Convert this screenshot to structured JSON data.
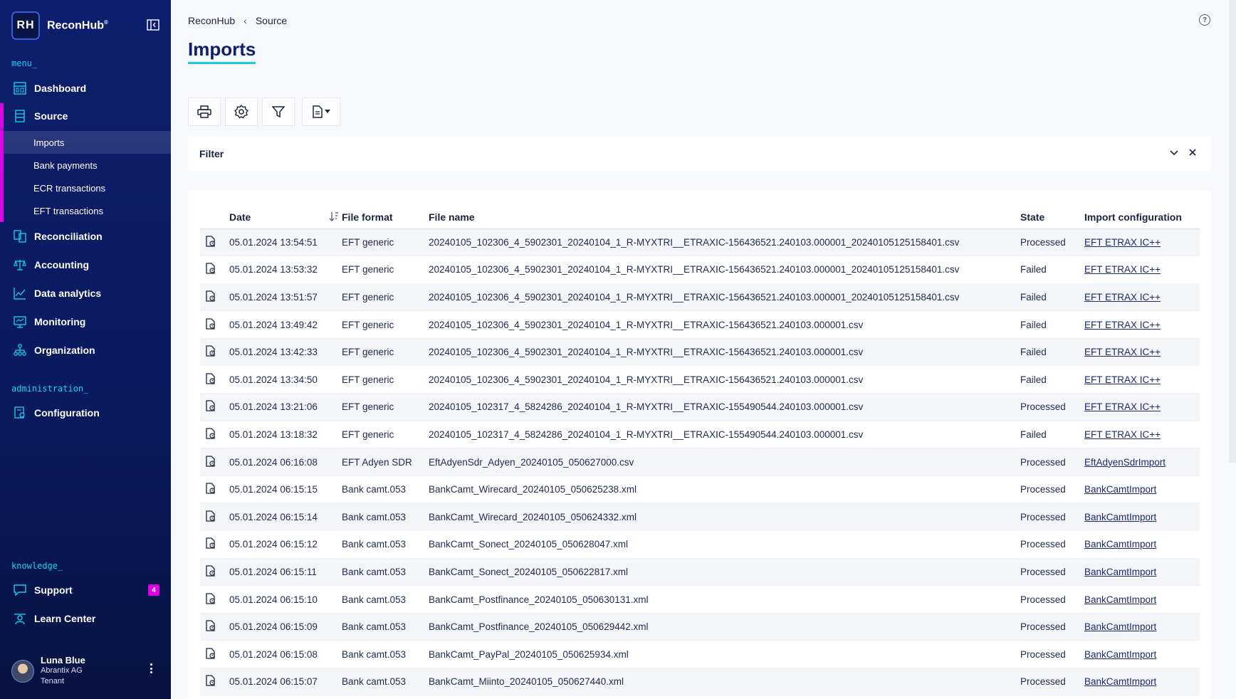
{
  "app": {
    "name": "ReconHub",
    "logo_initials": "RH",
    "logo_mark": "®"
  },
  "sidebar": {
    "menu_label": "menu_",
    "admin_label": "administration_",
    "knowledge_label": "knowledge_",
    "items": [
      {
        "label": "Dashboard",
        "icon": "dashboard-icon"
      },
      {
        "label": "Source",
        "icon": "source-icon"
      },
      {
        "label": "Reconciliation",
        "icon": "reconciliation-icon"
      },
      {
        "label": "Accounting",
        "icon": "scales-icon"
      },
      {
        "label": "Data analytics",
        "icon": "chart-line-icon"
      },
      {
        "label": "Monitoring",
        "icon": "monitoring-icon"
      },
      {
        "label": "Organization",
        "icon": "org-tree-icon"
      }
    ],
    "source_sub": [
      {
        "label": "Imports"
      },
      {
        "label": "Bank payments"
      },
      {
        "label": "ECR transactions"
      },
      {
        "label": "EFT transactions"
      }
    ],
    "admin_items": [
      {
        "label": "Configuration",
        "icon": "config-icon"
      }
    ],
    "knowledge_items": [
      {
        "label": "Support",
        "icon": "chat-icon",
        "badge": "4"
      },
      {
        "label": "Learn Center",
        "icon": "learn-icon"
      }
    ],
    "user": {
      "name": "Luna Blue",
      "company": "Abrantix AG",
      "role": "Tenant"
    }
  },
  "breadcrumb": {
    "root": "ReconHub",
    "current": "Source"
  },
  "page": {
    "title": "Imports"
  },
  "filter": {
    "label": "Filter"
  },
  "colors": {
    "accent": "#18c9e9",
    "highlight": "#e000e6",
    "sidebar": "#0d1e6e"
  },
  "table": {
    "headers": {
      "date": "Date",
      "format": "File format",
      "name": "File name",
      "state": "State",
      "config": "Import configuration"
    },
    "rows": [
      {
        "date": "05.01.2024 13:54:51",
        "format": "EFT generic",
        "name": "20240105_102306_4_5902301_20240104_1_R-MYXTRI__ETRAXIC-156436521.240103.000001_20240105125158401.csv",
        "state": "Processed",
        "config": "EFT ETRAX IC++"
      },
      {
        "date": "05.01.2024 13:53:32",
        "format": "EFT generic",
        "name": "20240105_102306_4_5902301_20240104_1_R-MYXTRI__ETRAXIC-156436521.240103.000001_20240105125158401.csv",
        "state": "Failed",
        "config": "EFT ETRAX IC++"
      },
      {
        "date": "05.01.2024 13:51:57",
        "format": "EFT generic",
        "name": "20240105_102306_4_5902301_20240104_1_R-MYXTRI__ETRAXIC-156436521.240103.000001_20240105125158401.csv",
        "state": "Failed",
        "config": "EFT ETRAX IC++"
      },
      {
        "date": "05.01.2024 13:49:42",
        "format": "EFT generic",
        "name": "20240105_102306_4_5902301_20240104_1_R-MYXTRI__ETRAXIC-156436521.240103.000001.csv",
        "state": "Failed",
        "config": "EFT ETRAX IC++"
      },
      {
        "date": "05.01.2024 13:42:33",
        "format": "EFT generic",
        "name": "20240105_102306_4_5902301_20240104_1_R-MYXTRI__ETRAXIC-156436521.240103.000001.csv",
        "state": "Failed",
        "config": "EFT ETRAX IC++"
      },
      {
        "date": "05.01.2024 13:34:50",
        "format": "EFT generic",
        "name": "20240105_102306_4_5902301_20240104_1_R-MYXTRI__ETRAXIC-156436521.240103.000001.csv",
        "state": "Failed",
        "config": "EFT ETRAX IC++"
      },
      {
        "date": "05.01.2024 13:21:06",
        "format": "EFT generic",
        "name": "20240105_102317_4_5824286_20240104_1_R-MYXTRI__ETRAXIC-155490544.240103.000001.csv",
        "state": "Processed",
        "config": "EFT ETRAX IC++"
      },
      {
        "date": "05.01.2024 13:18:32",
        "format": "EFT generic",
        "name": "20240105_102317_4_5824286_20240104_1_R-MYXTRI__ETRAXIC-155490544.240103.000001.csv",
        "state": "Failed",
        "config": "EFT ETRAX IC++"
      },
      {
        "date": "05.01.2024 06:16:08",
        "format": "EFT Adyen SDR",
        "name": "EftAdyenSdr_Adyen_20240105_050627000.csv",
        "state": "Processed",
        "config": "EftAdyenSdrImport"
      },
      {
        "date": "05.01.2024 06:15:15",
        "format": "Bank camt.053",
        "name": "BankCamt_Wirecard_20240105_050625238.xml",
        "state": "Processed",
        "config": "BankCamtImport"
      },
      {
        "date": "05.01.2024 06:15:14",
        "format": "Bank camt.053",
        "name": "BankCamt_Wirecard_20240105_050624332.xml",
        "state": "Processed",
        "config": "BankCamtImport"
      },
      {
        "date": "05.01.2024 06:15:12",
        "format": "Bank camt.053",
        "name": "BankCamt_Sonect_20240105_050628047.xml",
        "state": "Processed",
        "config": "BankCamtImport"
      },
      {
        "date": "05.01.2024 06:15:11",
        "format": "Bank camt.053",
        "name": "BankCamt_Sonect_20240105_050622817.xml",
        "state": "Processed",
        "config": "BankCamtImport"
      },
      {
        "date": "05.01.2024 06:15:10",
        "format": "Bank camt.053",
        "name": "BankCamt_Postfinance_20240105_050630131.xml",
        "state": "Processed",
        "config": "BankCamtImport"
      },
      {
        "date": "05.01.2024 06:15:09",
        "format": "Bank camt.053",
        "name": "BankCamt_Postfinance_20240105_050629442.xml",
        "state": "Processed",
        "config": "BankCamtImport"
      },
      {
        "date": "05.01.2024 06:15:08",
        "format": "Bank camt.053",
        "name": "BankCamt_PayPal_20240105_050625934.xml",
        "state": "Processed",
        "config": "BankCamtImport"
      },
      {
        "date": "05.01.2024 06:15:07",
        "format": "Bank camt.053",
        "name": "BankCamt_Miinto_20240105_050627440.xml",
        "state": "Processed",
        "config": "BankCamtImport"
      }
    ]
  }
}
